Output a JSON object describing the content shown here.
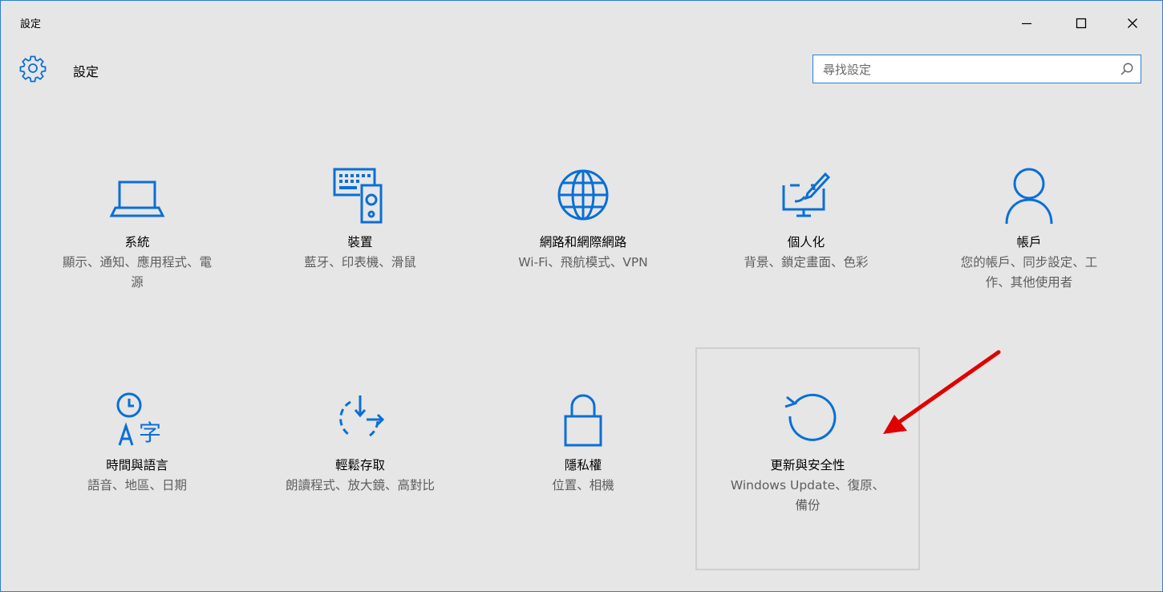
{
  "window": {
    "title": "設定",
    "controls": {
      "minimize": "minimize-icon",
      "maximize": "maximize-icon",
      "close": "close-icon"
    }
  },
  "header": {
    "title": "設定",
    "icon": "gear-icon"
  },
  "search": {
    "placeholder": "尋找設定",
    "value": "",
    "icon": "search-icon"
  },
  "colors": {
    "accent": "#0a6fd6",
    "border_accent": "#2b7fd6",
    "background": "#e6e6e6",
    "description_text": "#5e5e5e",
    "annotation_arrow": "#e00000"
  },
  "tiles": [
    {
      "name": "系統",
      "description": "顯示、通知、應用程式、電源",
      "icon": "laptop-icon"
    },
    {
      "name": "裝置",
      "description": "藍牙、印表機、滑鼠",
      "icon": "devices-icon"
    },
    {
      "name": "網路和網際網路",
      "description": "Wi-Fi、飛航模式、VPN",
      "icon": "globe-icon"
    },
    {
      "name": "個人化",
      "description": "背景、鎖定畫面、色彩",
      "icon": "personalization-icon"
    },
    {
      "name": "帳戶",
      "description": "您的帳戶、同步設定、工作、其他使用者",
      "icon": "person-icon"
    },
    {
      "name": "時間與語言",
      "description": "語音、地區、日期",
      "icon": "time-language-icon"
    },
    {
      "name": "輕鬆存取",
      "description": "朗讀程式、放大鏡、高對比",
      "icon": "ease-of-access-icon"
    },
    {
      "name": "隱私權",
      "description": "位置、相機",
      "icon": "lock-icon"
    },
    {
      "name": "更新與安全性",
      "description": "Windows Update、復原、備份",
      "icon": "refresh-icon",
      "selected": true
    }
  ],
  "annotation": {
    "arrow": "red-arrow-icon"
  }
}
